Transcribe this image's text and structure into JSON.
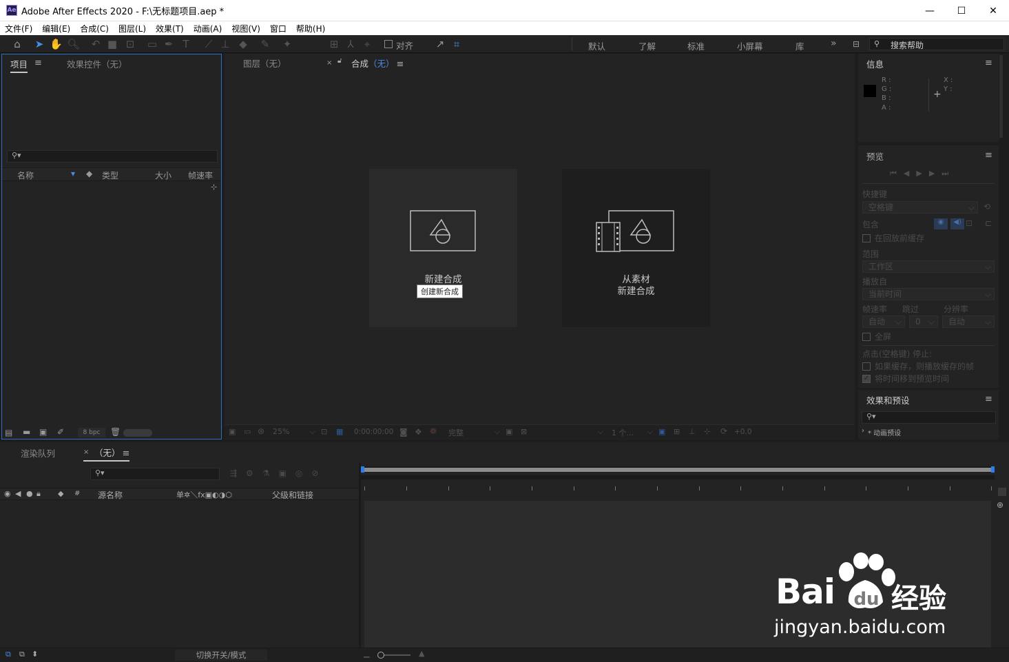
{
  "window": {
    "app_badge": "Ae",
    "title": "Adobe After Effects 2020 - F:\\无标题项目.aep *",
    "minimize": "—",
    "maximize": "☐",
    "close": "✕"
  },
  "menu": [
    "文件(F)",
    "编辑(E)",
    "合成(C)",
    "图层(L)",
    "效果(T)",
    "动画(A)",
    "视图(V)",
    "窗口",
    "帮助(H)"
  ],
  "toolbar": {
    "align_label": "对齐",
    "workspaces": [
      "默认",
      "了解",
      "标准",
      "小屏幕",
      "库"
    ],
    "more": "»",
    "search_help": "搜索帮助"
  },
  "project_panel": {
    "tab_project": "项目",
    "tab_effects": "效果控件（无）",
    "columns": [
      "名称",
      "类型",
      "大小",
      "帧速率"
    ],
    "bpc": "8 bpc"
  },
  "viewer": {
    "tab_layer": "图层（无）",
    "tab_comp_prefix": "合成",
    "tab_comp_suffix": "（无）",
    "card_new_comp": "新建合成",
    "tooltip": "创建新合成",
    "card_from_footage_1": "从素材",
    "card_from_footage_2": "新建合成",
    "footer": {
      "zoom": "25%",
      "timecode": "0:00:00:00",
      "resolution": "完整",
      "view": "1 个...",
      "exposure": "+0.0"
    }
  },
  "info_panel": {
    "title": "信息",
    "r": "R :",
    "g": "G :",
    "b": "B :",
    "a": "A :",
    "x": "X :",
    "y": "Y :"
  },
  "preview_panel": {
    "title": "预览",
    "shortcut_label": "快捷键",
    "shortcut_value": "空格键",
    "include_label": "包含",
    "cache_before": "在回放前缓存",
    "range_label": "范围",
    "range_value": "工作区",
    "play_from_label": "播放自",
    "play_from_value": "当前时间",
    "framerate_label": "帧速率",
    "skip_label": "跳过",
    "resolution_label": "分辨率",
    "framerate_value": "自动",
    "skip_value": "0",
    "resolution_value": "自动",
    "fullscreen": "全屏",
    "stop_label": "点击(空格键) 停止:",
    "opt1": "如果缓存，则播放缓存的帧",
    "opt2": "将时间移到预览时间"
  },
  "effects_panel": {
    "title": "效果和预设",
    "item": "* 动画预设"
  },
  "timeline": {
    "tab_render": "渲染队列",
    "tab_comp": "（无）",
    "col_source": "源名称",
    "col_parent": "父级和链接",
    "col_num": "#",
    "col_switches": "单✲＼fx▣◐◑⬡",
    "footer_toggle": "切换开关/模式"
  },
  "watermark": {
    "brand": "Bai",
    "brand_suffix": "经验",
    "url": "jingyan.baidu.com"
  },
  "colors": {
    "accent": "#4b8ce8",
    "panel_bg": "#232323",
    "frame_bg": "#1d1d1d"
  }
}
